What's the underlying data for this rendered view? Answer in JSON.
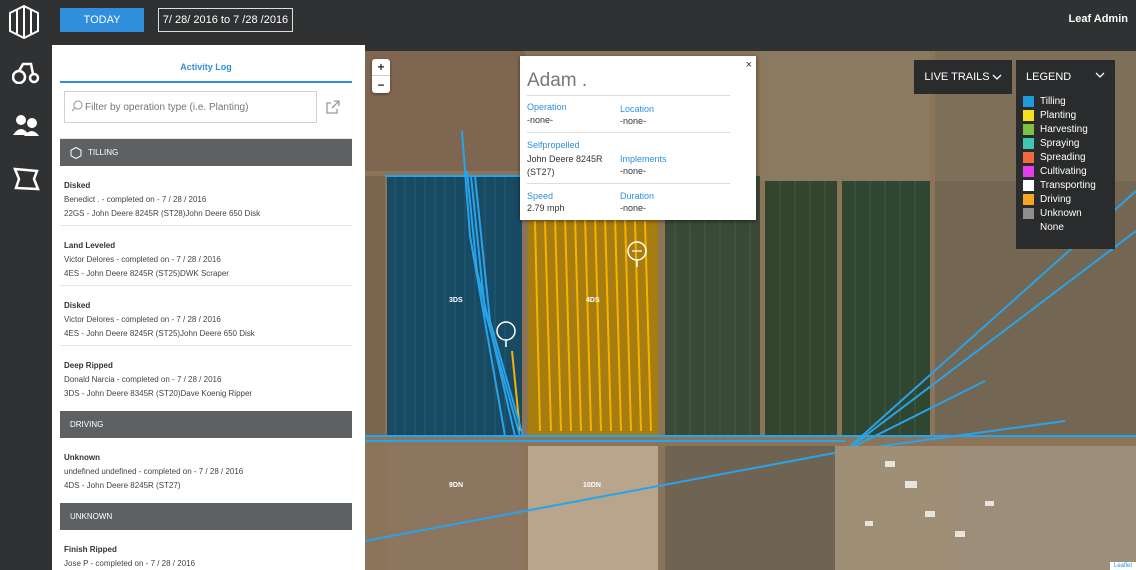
{
  "header": {
    "today_label": "TODAY",
    "date_range": "7/ 28/ 2016 to 7 /28 /2016",
    "user_name": "Leaf Admin"
  },
  "nav": {
    "icons": [
      "tractor-icon",
      "users-icon",
      "field-icon"
    ]
  },
  "activity": {
    "tab_label": "Activity Log",
    "filter_placeholder": "Filter by operation type (i.e. Planting)",
    "sections": [
      {
        "title": "TILLING",
        "entries": [
          {
            "title": "Disked",
            "line1": "Benedict . - completed on - 7 / 28 / 2016",
            "line2": "22GS - John Deere 8245R (ST28)John Deere 650 Disk"
          },
          {
            "title": "Land Leveled",
            "line1": "Victor Delores - completed on - 7 / 28 / 2016",
            "line2": "4ES - John Deere 8245R (ST25)DWK Scraper"
          },
          {
            "title": "Disked",
            "line1": "Victor Delores - completed on - 7 / 28 / 2016",
            "line2": "4ES - John Deere 8245R (ST25)John Deere 650 Disk"
          },
          {
            "title": "Deep Ripped",
            "line1": "Donald Narcia - completed on - 7 / 28 / 2016",
            "line2": "3DS - John Deere 8345R (ST20)Dave Koenig Ripper"
          }
        ]
      },
      {
        "title": "DRIVING",
        "entries": [
          {
            "title": "Unknown",
            "line1": "undefined undefined - completed on - 7 / 28 / 2016",
            "line2": "4DS - John Deere 8245R (ST27)"
          }
        ]
      },
      {
        "title": "UNKNOWN",
        "entries": [
          {
            "title": "Finish Ripped",
            "line1": "Jose P - completed on - 7 / 28 / 2016",
            "line2": ""
          }
        ]
      }
    ]
  },
  "map": {
    "zoom_in": "+",
    "zoom_out": "−",
    "live_trails_label": "LIVE TRAILS",
    "legend_title": "LEGEND",
    "legend": [
      {
        "label": "Tilling",
        "color": "#1f9bdb"
      },
      {
        "label": "Planting",
        "color": "#f4e21e"
      },
      {
        "label": "Harvesting",
        "color": "#7cc242"
      },
      {
        "label": "Spraying",
        "color": "#3ec6b0"
      },
      {
        "label": "Spreading",
        "color": "#f06a3e"
      },
      {
        "label": "Cultivating",
        "color": "#e53fe9"
      },
      {
        "label": "Transporting",
        "color": "#ffffff"
      },
      {
        "label": "Driving",
        "color": "#f5a623"
      },
      {
        "label": "Unknown",
        "color": "#8e8e8e"
      },
      {
        "label": "None",
        "color": ""
      }
    ],
    "field_labels": [
      "3DS",
      "4DS",
      "9DN",
      "10DN"
    ],
    "attribution": "Leaflet",
    "popup": {
      "name": "Adam .",
      "close": "×",
      "operation_label": "Operation",
      "operation_value": "-none-",
      "location_label": "Location",
      "location_value": "-none-",
      "selfpropelled_label": "Selfpropelled",
      "selfpropelled_value": "John Deere 8245R (ST27)",
      "implements_label": "Implements",
      "implements_value": "-none-",
      "speed_label": "Speed",
      "speed_value": "2.79 mph",
      "duration_label": "Duration",
      "duration_value": "-none-"
    }
  }
}
